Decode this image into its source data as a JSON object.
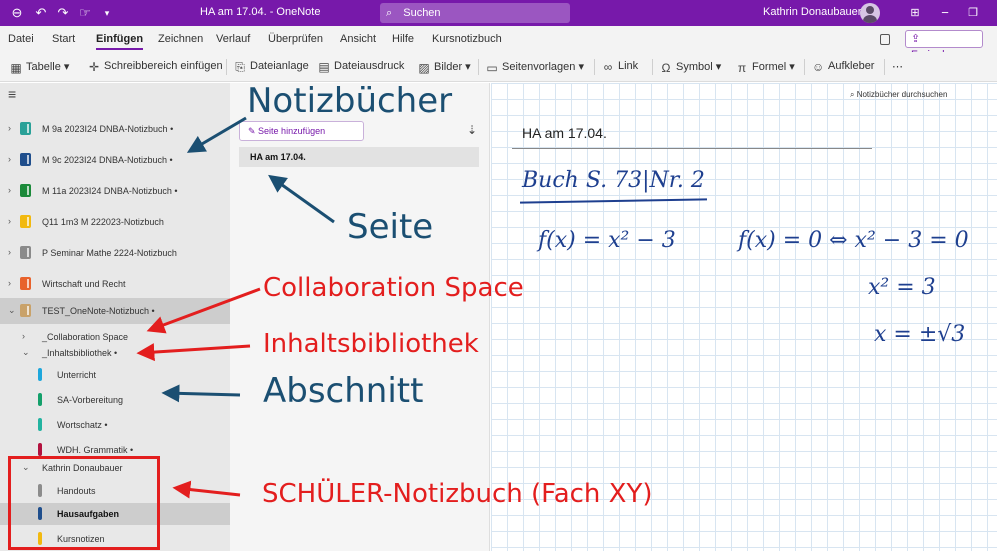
{
  "titlebar": {
    "title": "HA am 17.04. - OneNote",
    "search_placeholder": "Suchen",
    "user_name": "Kathrin Donaubauer",
    "accent": "#7719aa"
  },
  "menu": {
    "tabs": [
      "Datei",
      "Start",
      "Einfügen",
      "Zeichnen",
      "Verlauf",
      "Überprüfen",
      "Ansicht",
      "Hilfe",
      "Kursnotizbuch"
    ],
    "active_tab": "Einfügen",
    "share_label": "Freigeben"
  },
  "ribbon": {
    "table": "Tabelle",
    "insert_space": "Schreibbereich einfügen",
    "attachment": "Dateianlage",
    "printout": "Dateiausdruck",
    "pictures": "Bilder",
    "templates": "Seitenvorlagen",
    "link": "Link",
    "symbol": "Symbol",
    "formula": "Formel",
    "sticker": "Aufkleber",
    "more": "⋯"
  },
  "sidebar": {
    "notebooks": [
      {
        "label": "M 9a 2023I24 DNBA-Notizbuch •",
        "color": "#2aa198"
      },
      {
        "label": "M 9c 2023I24 DNBA-Notizbuch •",
        "color": "#1f4e8c"
      },
      {
        "label": "M 11a 2023I24 DNBA-Notizbuch •",
        "color": "#1b8a3a"
      },
      {
        "label": "Q11 1m3 M 222023-Notizbuch",
        "color": "#f2b90f"
      },
      {
        "label": "P Seminar Mathe 2224-Notizbuch",
        "color": "#8a8a8a"
      },
      {
        "label": "Wirtschaft und Recht",
        "color": "#e8622c"
      },
      {
        "label": "TEST_OneNote-Notizbuch •",
        "color": "#c9a26a"
      }
    ],
    "section_groups": [
      {
        "label": "_Collaboration Space",
        "chevron": "›"
      },
      {
        "label": "_Inhaltsbibliothek •",
        "chevron": "⌄"
      }
    ],
    "library_sections": [
      {
        "label": "Unterricht",
        "color": "#1ea7dc"
      },
      {
        "label": "SA-Vorbereitung",
        "color": "#14a06b"
      },
      {
        "label": "Wortschatz •",
        "color": "#22b3a0"
      },
      {
        "label": "WDH. Grammatik •",
        "color": "#b3123e"
      }
    ],
    "student_group": "Kathrin Donaubauer",
    "student_sections": [
      {
        "label": "Handouts",
        "color": "#8c8c8c"
      },
      {
        "label": "Hausaufgaben",
        "color": "#1f4e8c"
      },
      {
        "label": "Kursnotizen",
        "color": "#f2b90f"
      }
    ]
  },
  "pages": {
    "add_page_label": "Seite hinzufügen",
    "items": [
      "HA am 17.04."
    ]
  },
  "canvas": {
    "search_placeholder": "Notizbücher durchsuchen",
    "page_title": "HA am 17.04.",
    "ink": {
      "line1": "Buch S. 73|Nr. 2",
      "eq1": "f(x) = x² − 3",
      "eq2": "f(x) = 0  ⇔  x² − 3 = 0",
      "eq3": "x²   = 3",
      "eq4": "x   = ±√3"
    }
  },
  "annotations": {
    "notizbuecher": "Notizbücher",
    "seite": "Seite",
    "collaboration": "Collaboration Space",
    "inhaltsbibliothek": "Inhaltsbibliothek",
    "abschnitt": "Abschnitt",
    "schueler": "SCHÜLER-Notizbuch (Fach XY)"
  }
}
